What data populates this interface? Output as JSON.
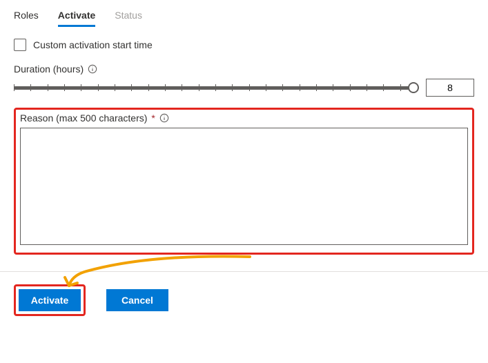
{
  "tabs": {
    "roles": "Roles",
    "activate": "Activate",
    "status": "Status"
  },
  "customStart": {
    "label": "Custom activation start time",
    "checked": false
  },
  "duration": {
    "label": "Duration (hours)",
    "value": "8",
    "min": 0,
    "max": 8
  },
  "reason": {
    "label": "Reason (max 500 characters)",
    "required": "*",
    "value": ""
  },
  "buttons": {
    "activate": "Activate",
    "cancel": "Cancel"
  },
  "colors": {
    "primary": "#0078d4",
    "highlight": "#e3261f",
    "arrow": "#f2a100"
  }
}
